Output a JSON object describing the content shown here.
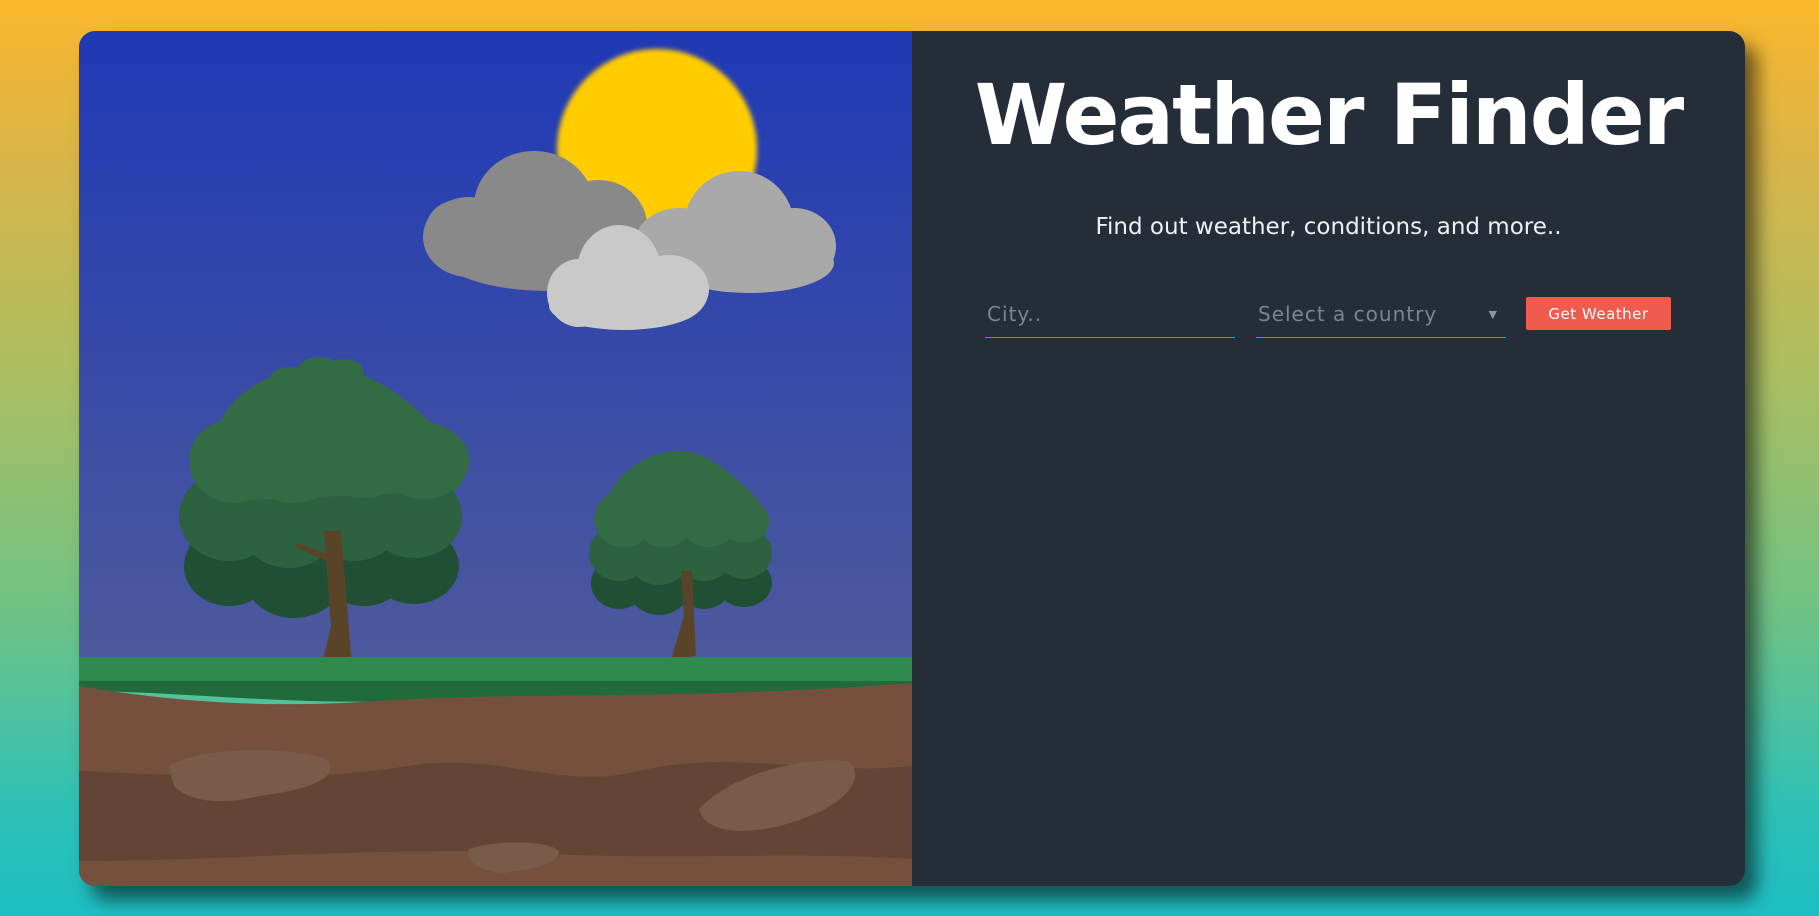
{
  "app": {
    "title": "Weather Finder",
    "subtitle": "Find out weather, conditions, and more.."
  },
  "form": {
    "city_placeholder": "City..",
    "city_value": "",
    "country_selected": "Select a country",
    "submit_label": "Get Weather"
  },
  "colors": {
    "accent_button": "#ef5b4f",
    "panel_bg": "#252e38",
    "input_underline": "#1fa3d6",
    "sky_top": "#1f39b5",
    "sun": "#ffcc00"
  },
  "icons": {
    "select_caret": "caret-down-icon"
  }
}
